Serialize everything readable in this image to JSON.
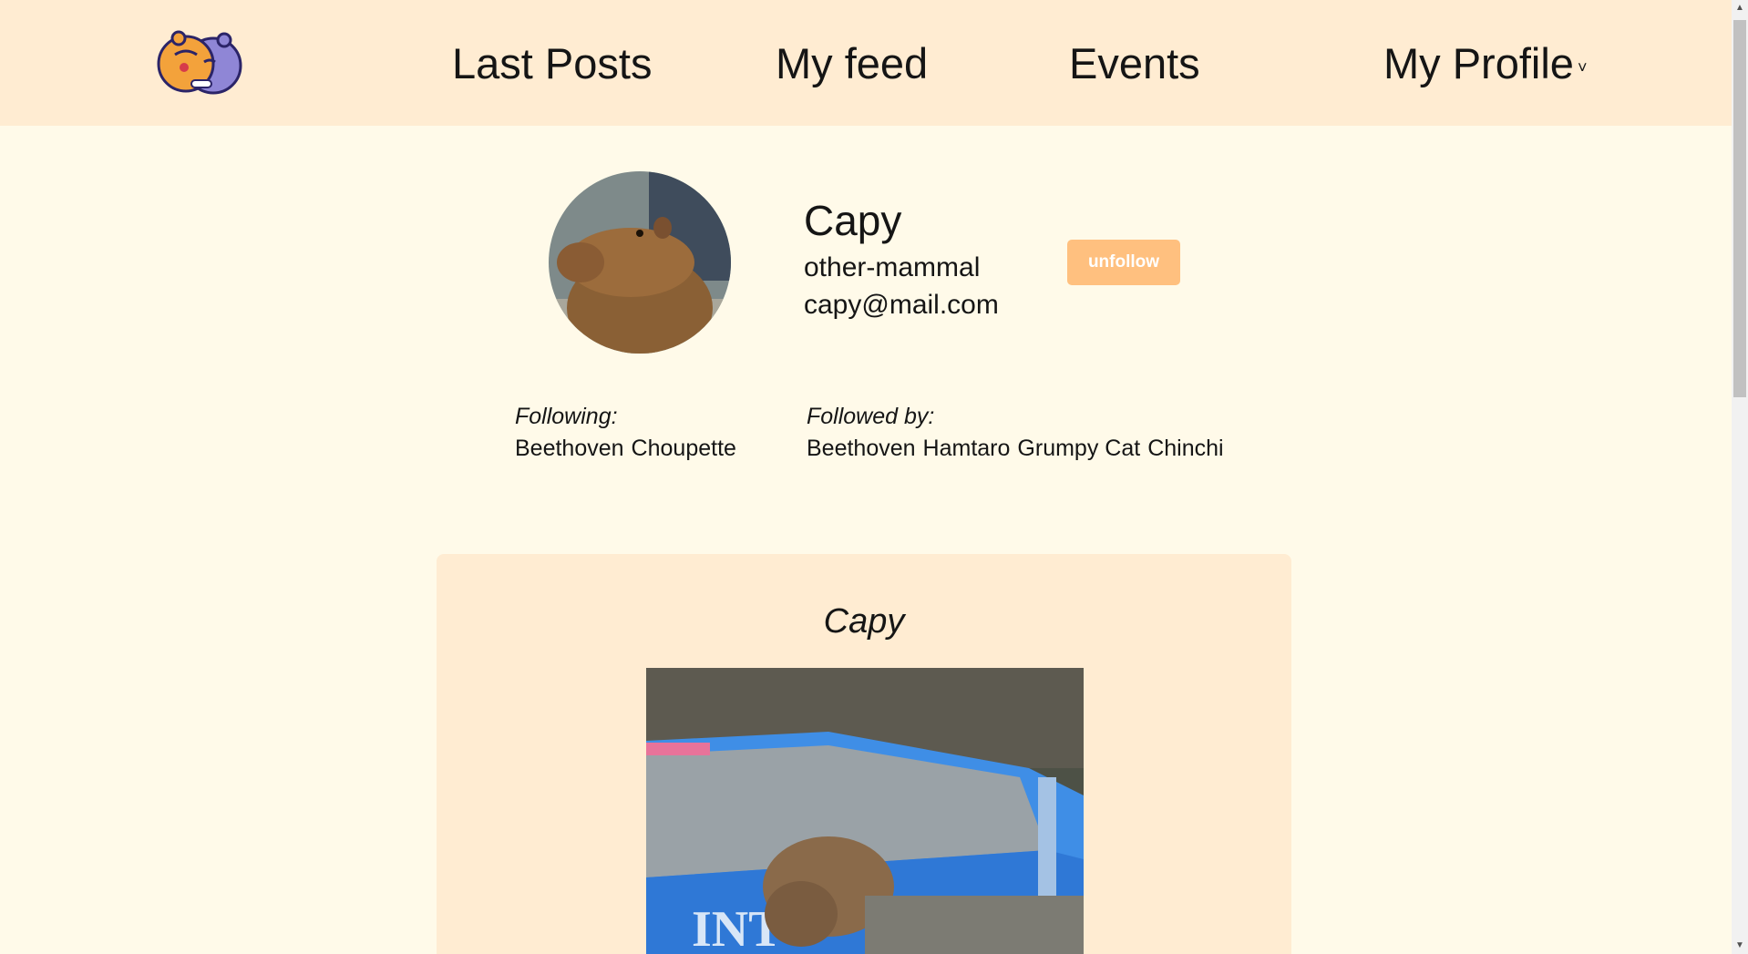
{
  "nav": {
    "logo_alt": "Pet social logo",
    "links": [
      "Last Posts",
      "My feed",
      "Events",
      "My Profile"
    ],
    "profile_chevron": "˅"
  },
  "profile": {
    "name": "Capy",
    "species": "other-mammal",
    "email": "capy@mail.com",
    "action_label": "unfollow",
    "following_label": "Following:",
    "following": [
      "Beethoven",
      "Choupette"
    ],
    "followed_label": "Followed by:",
    "followed_by": [
      "Beethoven",
      "Hamtaro",
      "Grumpy Cat",
      "Chinchi"
    ]
  },
  "post": {
    "title": "Capy",
    "image_alt": "Capybara next to a blue pool"
  },
  "colors": {
    "nav_bg": "#ffecd2",
    "page_bg": "#fffae9",
    "button_bg": "#ffc07f",
    "card_bg": "#ffecd2"
  }
}
